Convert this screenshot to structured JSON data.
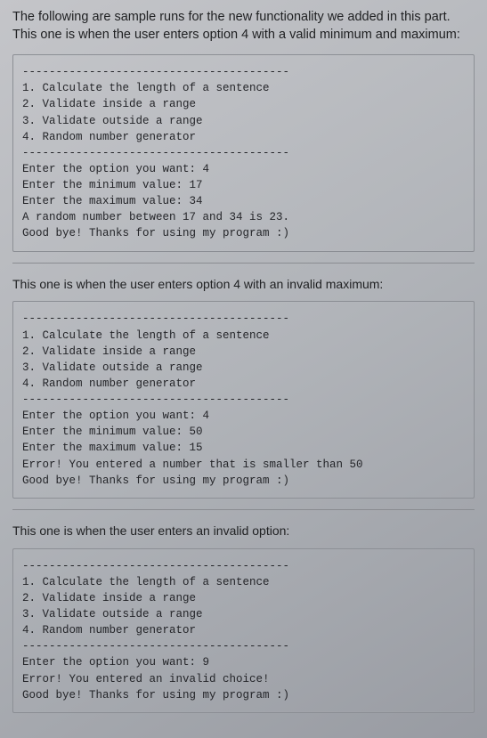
{
  "section1": {
    "intro": "The following are sample runs for the new functionality we added in this part. This one is when the user enters option 4 with a valid minimum and maximum:",
    "dash1": "----------------------------------------",
    "menu1": "1. Calculate the length of a sentence",
    "menu2": "2. Validate inside a range",
    "menu3": "3. Validate outside a range",
    "menu4": "4. Random number generator",
    "dash2": "----------------------------------------",
    "prompt1": "Enter the option you want: 4",
    "prompt2": "Enter the minimum value: 17",
    "prompt3": "Enter the maximum value: 34",
    "result": "A random number between 17 and 34 is 23.",
    "bye": "Good bye! Thanks for using my program :)"
  },
  "section2": {
    "intro": "This one is when the user enters option 4 with an invalid maximum:",
    "dash1": "----------------------------------------",
    "menu1": "1. Calculate the length of a sentence",
    "menu2": "2. Validate inside a range",
    "menu3": "3. Validate outside a range",
    "menu4": "4. Random number generator",
    "dash2": "----------------------------------------",
    "prompt1": "Enter the option you want: 4",
    "prompt2": "Enter the minimum value: 50",
    "prompt3": "Enter the maximum value: 15",
    "result": "Error! You entered a number that is smaller than 50",
    "bye": "Good bye! Thanks for using my program :)"
  },
  "section3": {
    "intro": "This one is when the user enters an invalid option:",
    "dash1": "----------------------------------------",
    "menu1": "1. Calculate the length of a sentence",
    "menu2": "2. Validate inside a range",
    "menu3": "3. Validate outside a range",
    "menu4": "4. Random number generator",
    "dash2": "----------------------------------------",
    "prompt1": "Enter the option you want: 9",
    "result": "Error! You entered an invalid choice!",
    "bye": "Good bye! Thanks for using my program :)"
  }
}
